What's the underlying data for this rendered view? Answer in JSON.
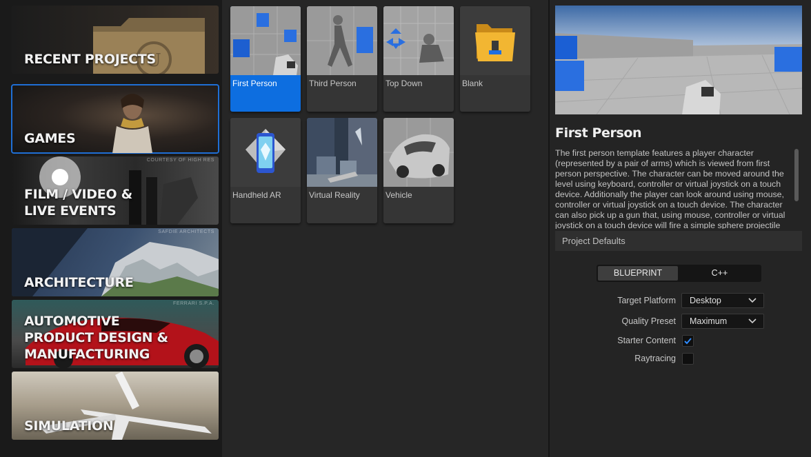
{
  "categories": [
    {
      "label": "RECENT PROJECTS",
      "credit": ""
    },
    {
      "label": "GAMES",
      "credit": ""
    },
    {
      "label_line1": "FILM / VIDEO &",
      "label_line2": "LIVE EVENTS",
      "credit": "COURTESY OF HIGH RES"
    },
    {
      "label": "ARCHITECTURE",
      "credit": "SAFDIE ARCHITECTS"
    },
    {
      "label_line1": "AUTOMOTIVE",
      "label_line2": "PRODUCT DESIGN &",
      "label_line3": "MANUFACTURING",
      "credit": "FERRARI S.P.A."
    },
    {
      "label": "SIMULATION",
      "credit": ""
    }
  ],
  "templates": [
    {
      "label": "First Person",
      "icon": "first-person-thumbnail"
    },
    {
      "label": "Third Person",
      "icon": "third-person-thumbnail"
    },
    {
      "label": "Top Down",
      "icon": "top-down-thumbnail"
    },
    {
      "label": "Blank",
      "icon": "folder-icon"
    },
    {
      "label": "Handheld AR",
      "icon": "phone-ar-icon"
    },
    {
      "label": "Virtual Reality",
      "icon": "virtual-reality-thumbnail"
    },
    {
      "label": "Vehicle",
      "icon": "vehicle-thumbnail"
    }
  ],
  "details": {
    "title": "First Person",
    "description": "The first person template features a player character (represented by a pair of arms) which is viewed from first person perspective. The character can be moved around the level using keyboard, controller or virtual joystick on a touch device. Additionally the player can look around using mouse, controller or virtual joystick on a touch device. The character can also pick up a gun that, using mouse, controller or virtual joystick on a touch device will fire a simple sphere projectile",
    "project_defaults_label": "Project Defaults",
    "language_options": [
      "BLUEPRINT",
      "C++"
    ],
    "target_platform_label": "Target Platform",
    "target_platform_value": "Desktop",
    "quality_preset_label": "Quality Preset",
    "quality_preset_value": "Maximum",
    "starter_content_label": "Starter Content",
    "starter_content_checked": true,
    "raytracing_label": "Raytracing",
    "raytracing_checked": false
  },
  "colors": {
    "accent": "#0d6ee0",
    "panel": "#242424",
    "background": "#1a1a1a"
  }
}
